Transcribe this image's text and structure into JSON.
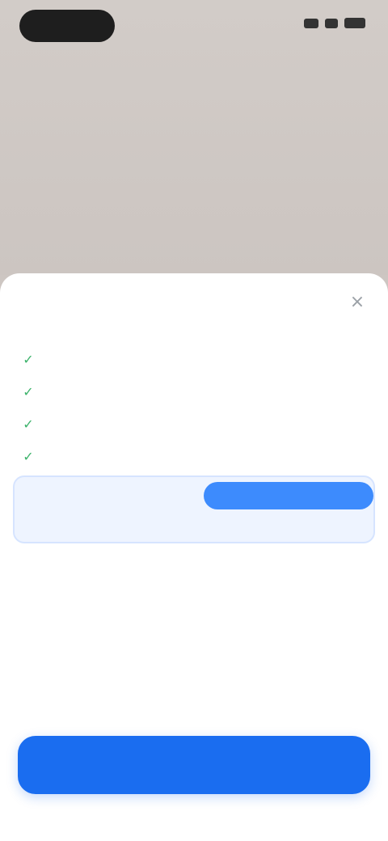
{
  "status_bar": {
    "time": "",
    "icons": [
      "signal-icon",
      "wifi-icon",
      "battery-icon"
    ]
  },
  "sheet": {
    "title": "",
    "close_label": "×",
    "features": [
      {
        "check": "✓",
        "text": ""
      },
      {
        "check": "✓",
        "text": ""
      },
      {
        "check": "✓",
        "text": ""
      },
      {
        "check": "✓",
        "text": ""
      }
    ],
    "plans": [
      {
        "name": "",
        "sub": "",
        "price": "",
        "detail": "",
        "badge": "",
        "selected": true
      },
      {
        "name": "",
        "sub": "",
        "price": "",
        "detail": "",
        "selected": false
      },
      {
        "name": "",
        "sub": "",
        "price": "",
        "detail": "",
        "selected": false
      }
    ],
    "cta_label": ""
  },
  "colors": {
    "accent": "#1a6df0",
    "badge": "#3d8bfd",
    "check": "#3db36b",
    "selected_bg": "#eef4ff",
    "backdrop": "#cdc6c2"
  }
}
